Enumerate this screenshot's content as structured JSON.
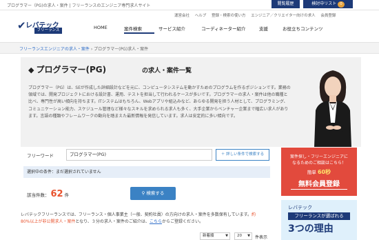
{
  "topbar": {
    "tagline": "プログラマー（PG)の求人・案件 | フリーランスのエンジニア専門求人サイト",
    "links": [
      "運営会社",
      "ヘルプ",
      "登録・検索の使い方",
      "エンジニア／クリエイター向けの求人",
      "会員登録"
    ],
    "history_label": "閲覧履歴",
    "favorites_label": "検討中リスト",
    "favorites_count": "0"
  },
  "logo": {
    "mark": "✔",
    "name": "レバテック",
    "sub": "フリーランス"
  },
  "nav": {
    "items": [
      "HOME",
      "案件検索",
      "サービス紹介",
      "コーディネーター紹介",
      "支援",
      "お役立ちコンテンツ"
    ],
    "active_index": 1
  },
  "breadcrumb": {
    "root": "フリーランスエンジニアの求人・案件",
    "current": "プログラマー(PG)求人・案件"
  },
  "hero": {
    "icon": "stack-icon",
    "title": "プログラマー(PG)",
    "subtitle": "の求人・案件一覧",
    "description": "プログラマー（PG）は、SEが作成した詳細設計などを元に、コンピュータシステムを動かすためのプログラムを作るポジションです。業務の領域では、開発プロジェクトにおける設計書、運用、テストを担当して行われるケースが多いです。プログラマーの求人・案件は他の職種と比べ、専門性が高い傾向を持ちます。ITシステムはもちろん、Webアプリや組込みなど、あらゆる開発を担う人材として、プログラミング、コミュニケーション能力、スケジュール管理など様々なスキルを求められる求人も多く、大手企業からベンチャー企業まで幅広い求人があります。言語の種類やフレームワークの動向を踏まえた最新情報を発信しています。求人は安定的に多い傾向です。"
  },
  "search": {
    "free_word_label": "フリーワード",
    "free_word_value": "プログラマー(PG)",
    "detail_button": "＋ 詳しい条件で検索する",
    "selected_label": "選択中の条件：まだ選択されていません",
    "count_label": "該当件数：",
    "count_value": "62",
    "count_unit": "件",
    "search_button": "検索する"
  },
  "banner_register": {
    "line1": "案件探し・フリーエンジニアに",
    "line2": "なるためのご相談はこちら！",
    "time_prefix": "簡単",
    "time_value": "60秒",
    "cta": "無料会員登録"
  },
  "banner_reasons": {
    "line1": "レバテック",
    "line2": "フリーランスが選ばれる",
    "line3": "3つの理由"
  },
  "footnote": {
    "text1": "レバテックフリーランスでは、フリーランス・個人事業主（一般、契約社員）の方向けの求人・案件を多数保有しています。",
    "highlight": "約80%以上が非公開求人・案件",
    "text2": "となり、３分の求人・案件のご紹介は、",
    "link": "こちら",
    "text3": "からご登録ください。"
  },
  "bottom": {
    "sort_value": "新着順",
    "per_page_value": "20",
    "per_page_label": "件表示"
  }
}
